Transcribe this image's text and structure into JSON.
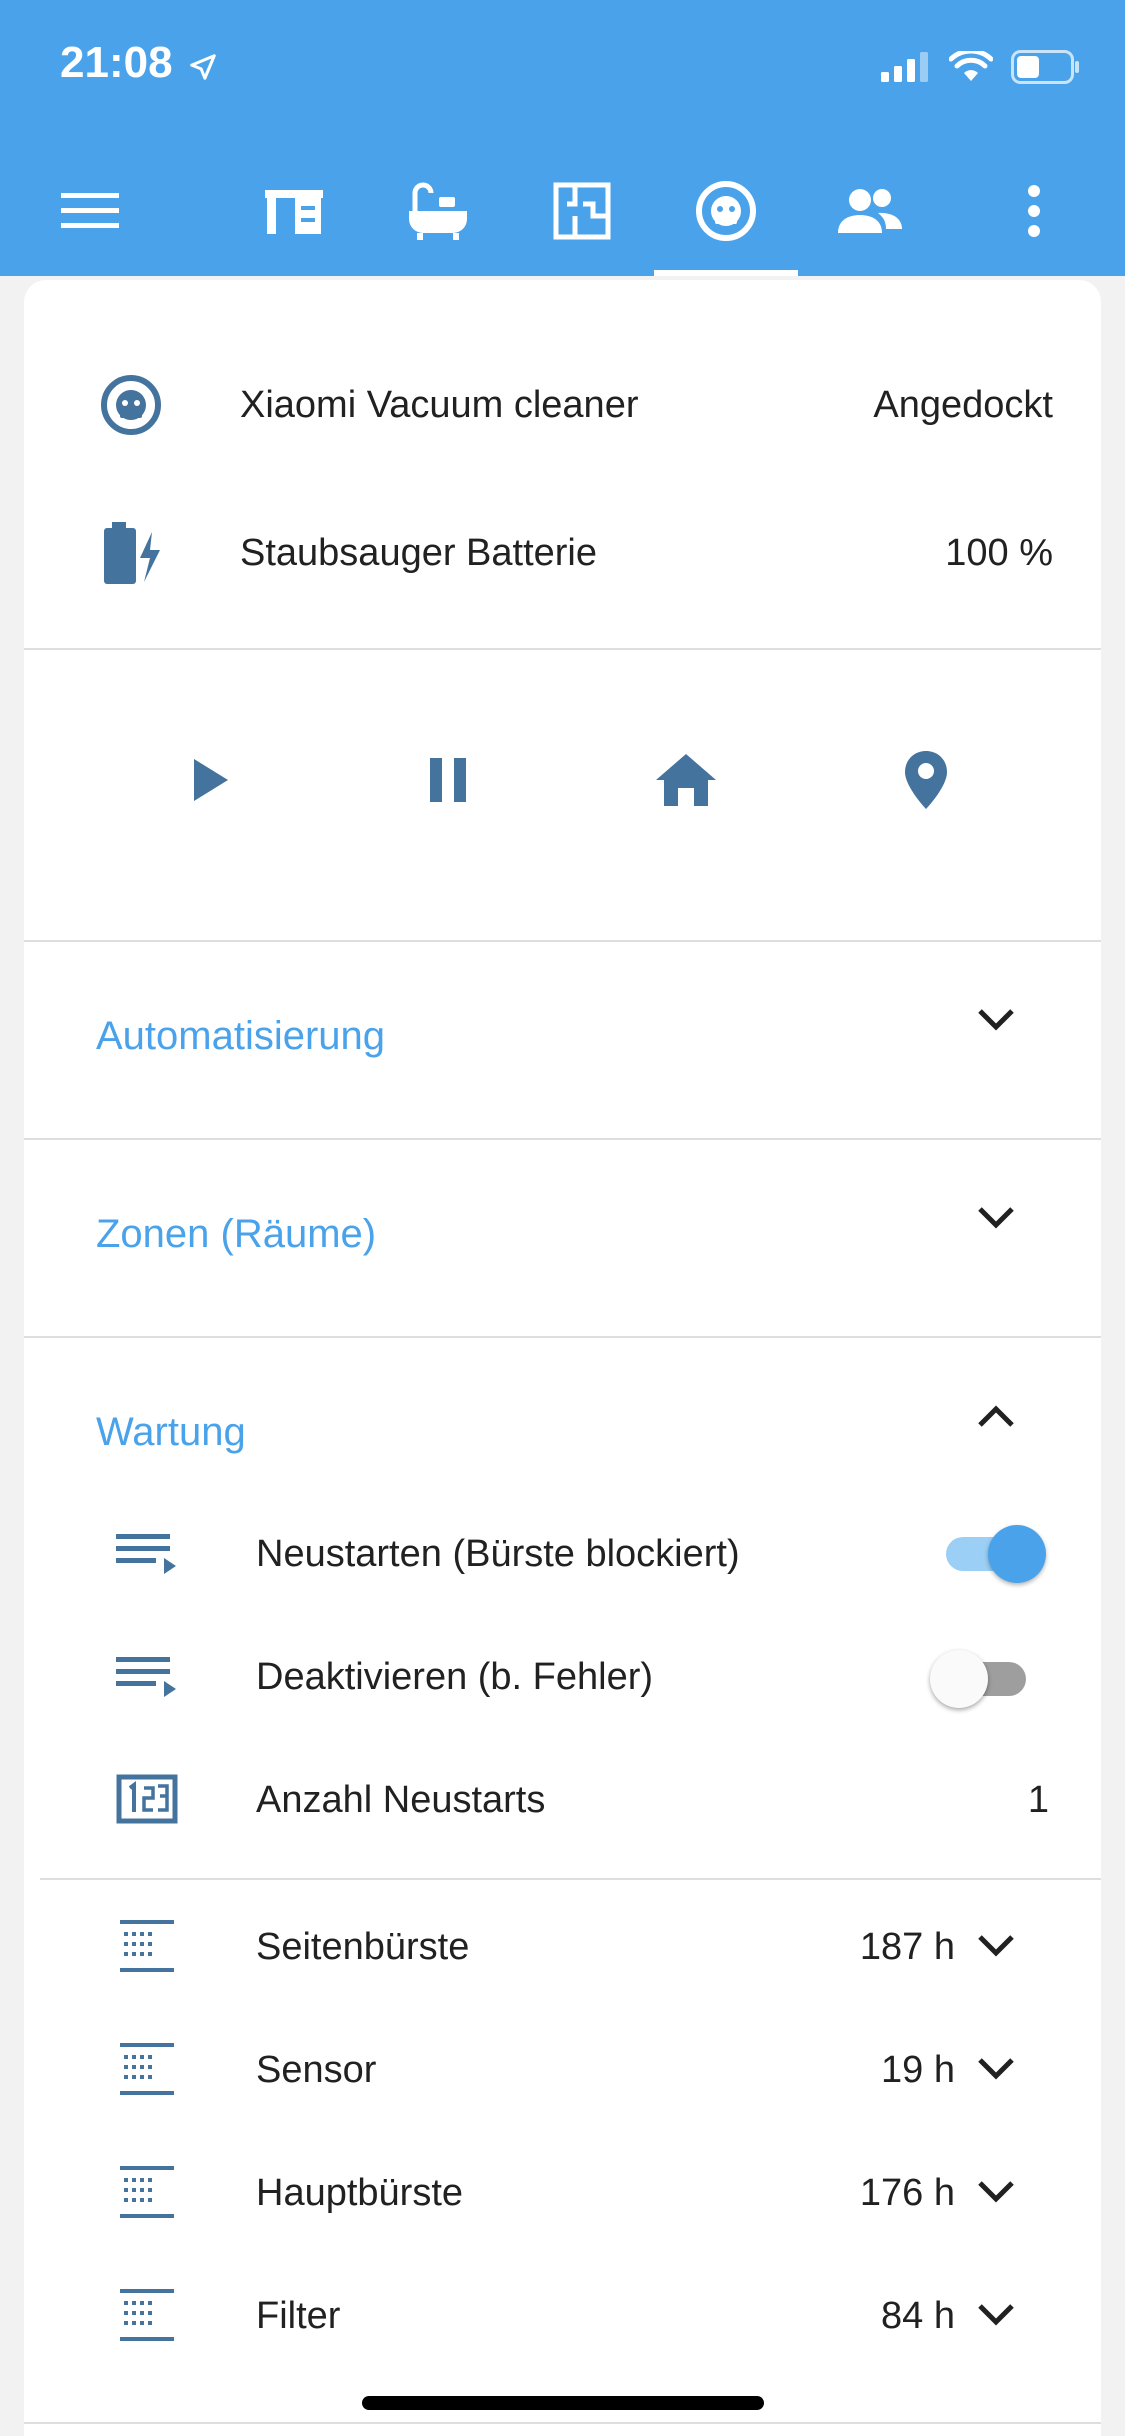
{
  "status_bar": {
    "time": "21:08"
  },
  "toolbar": {
    "menu_icon": "menu-icon",
    "tabs": [
      {
        "name": "furniture-icon"
      },
      {
        "name": "bathtub-icon"
      },
      {
        "name": "floor-plan-icon"
      },
      {
        "name": "robot-vacuum-icon",
        "active": true
      },
      {
        "name": "people-icon"
      }
    ],
    "more_icon": "more-vertical-icon"
  },
  "entities": [
    {
      "name": "Xiaomi Vacuum cleaner",
      "state": "Angedockt",
      "icon": "robot-vacuum-icon"
    },
    {
      "name": "Staubsauger Batterie",
      "state": "100 %",
      "icon": "battery-charging-icon"
    }
  ],
  "controls": [
    {
      "name": "play-icon"
    },
    {
      "name": "pause-icon"
    },
    {
      "name": "home-icon"
    },
    {
      "name": "map-marker-icon"
    }
  ],
  "sections": {
    "automation": {
      "title": "Automatisierung",
      "expanded": false
    },
    "zones": {
      "title": "Zonen (Räume)",
      "expanded": false
    },
    "maintenance": {
      "title": "Wartung",
      "expanded": true
    }
  },
  "maintenance": {
    "restart": {
      "label": "Neustarten (Bürste blockiert)",
      "on": true
    },
    "deactivate": {
      "label": "Deaktivieren (b. Fehler)",
      "on": false
    },
    "restart_count": {
      "label": "Anzahl Neustarts",
      "value": "1"
    },
    "consumables": [
      {
        "label": "Seitenbürste",
        "value": "187 h"
      },
      {
        "label": "Sensor",
        "value": "19 h"
      },
      {
        "label": "Hauptbürste",
        "value": "176 h"
      },
      {
        "label": "Filter",
        "value": "84 h"
      }
    ]
  },
  "colors": {
    "header": "#4aa3ea",
    "icon": "#44739e",
    "accent": "#4aa3ea"
  }
}
